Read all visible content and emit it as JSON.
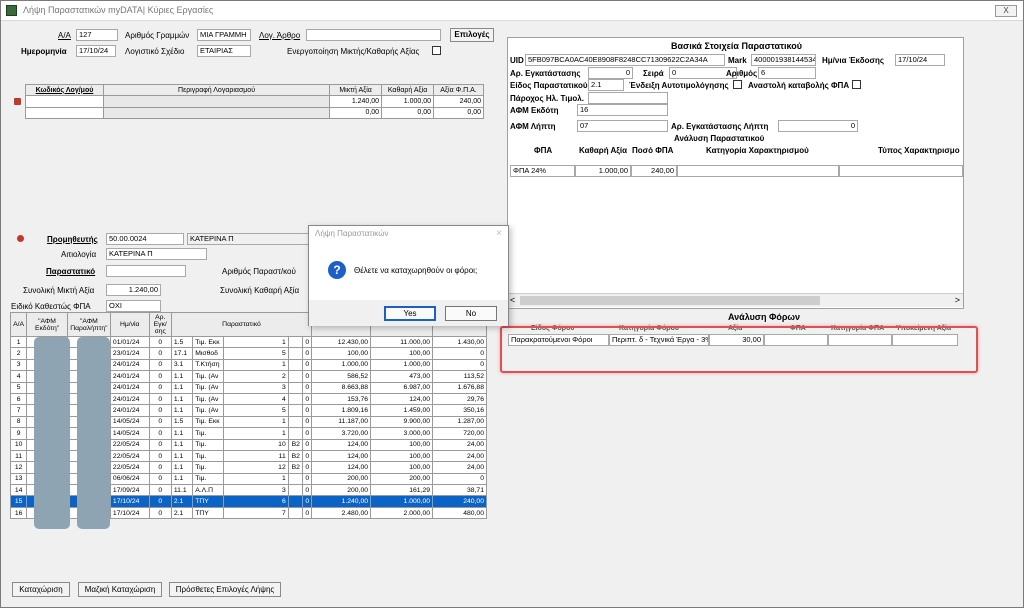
{
  "window": {
    "title": "Λήψη Παραστατικών myDATA| Κύριες Εργασίες",
    "close": "X"
  },
  "header": {
    "aa_label": "Α/Α",
    "aa_value": "127",
    "line_no_label": "Αριθμός Γραμμών",
    "line_no_value": "ΜΙΑ ΓΡΑΜΜΗ",
    "log_arthro_label": "Λογ. Άρθρο",
    "log_arthro_value": "",
    "options_button": "Επιλογές",
    "date_label": "Ημερομηνία",
    "date_value": "17/10/24",
    "plan_label": "Λογιστικό Σχέδιο",
    "plan_value": "ΕΤΑΙΡΙΑΣ",
    "mixed_label": "Ενεργοποίηση Μικτής/Καθαρής Αξίας"
  },
  "accounts_table": {
    "headers": [
      "Κωδικός Λογ/μού",
      "Περιγραφή Λογαριασμού",
      "Μικτή Αξία",
      "Καθαρή Αξία",
      "Αξία Φ.Π.Α."
    ],
    "rows": [
      [
        "",
        "",
        "1.240,00",
        "1.000,00",
        "240,00"
      ],
      [
        "",
        "",
        "0,00",
        "0,00",
        "0,00"
      ]
    ]
  },
  "supplier": {
    "label": "Προμηθευτής",
    "code": "50.00.0024",
    "name": "ΚΑΤΕΡΙΝΑ Π",
    "reason_label": "Αιτιολογία",
    "reason_value": "ΚΑΤΕΡΙΝΑ Π",
    "doc_label": "Παραστατικό",
    "doc_value": "",
    "doc_no_label": "Αριθμός Παραστ/κού",
    "gross_label": "Συνολική Μικτή Αξία",
    "gross_value": "1.240,00",
    "net_label": "Συνολική Καθαρή Αξία",
    "vat_status_label": "Ειδικό Καθεστώς ΦΠΑ",
    "vat_status_value": "ΟΧΙ"
  },
  "docs_table": {
    "headers": [
      "Α/Α",
      "\"ΑΦΜ Εκδότη\"",
      "\"ΑΦΜ Παραλήπτη\"",
      "Ημ/νία",
      "Αρ. Εγκ/σης",
      "Παραστατικό"
    ],
    "rows": [
      [
        "1",
        "",
        "",
        "01/01/24",
        "0",
        "1.5",
        "Τιμ. Εκκ",
        "1",
        "",
        "0",
        "12.430,00",
        "11.000,00",
        "1.430,00"
      ],
      [
        "2",
        "",
        "",
        "23/01/24",
        "0",
        "17.1",
        "Μισθοδ",
        "5",
        "",
        "0",
        "100,00",
        "100,00",
        "0"
      ],
      [
        "3",
        "",
        "",
        "24/01/24",
        "0",
        "3.1",
        "Τ.Κτήση",
        "1",
        "",
        "0",
        "1.000,00",
        "1.000,00",
        "0"
      ],
      [
        "4",
        "",
        "",
        "24/01/24",
        "0",
        "1.1",
        "Τιμ. (Αν",
        "2",
        "",
        "0",
        "586,52",
        "473,00",
        "113,52"
      ],
      [
        "5",
        "",
        "",
        "24/01/24",
        "0",
        "1.1",
        "Τιμ. (Αν",
        "3",
        "",
        "0",
        "8.663,88",
        "6.987,00",
        "1.676,88"
      ],
      [
        "6",
        "",
        "",
        "24/01/24",
        "0",
        "1.1",
        "Τιμ. (Αν",
        "4",
        "",
        "0",
        "153,76",
        "124,00",
        "29,76"
      ],
      [
        "7",
        "",
        "",
        "24/01/24",
        "0",
        "1.1",
        "Τιμ. (Αν",
        "5",
        "",
        "0",
        "1.809,16",
        "1.459,00",
        "350,16"
      ],
      [
        "8",
        "",
        "",
        "14/05/24",
        "0",
        "1.5",
        "Τιμ. Εκκ",
        "1",
        "",
        "0",
        "11.187,00",
        "9.900,00",
        "1.287,00"
      ],
      [
        "9",
        "",
        "",
        "14/05/24",
        "0",
        "1.1",
        "Τιμ.",
        "1",
        "",
        "0",
        "3.720,00",
        "3.000,00",
        "720,00"
      ],
      [
        "10",
        "",
        "",
        "22/05/24",
        "0",
        "1.1",
        "Τιμ.",
        "10",
        "B2",
        "0",
        "124,00",
        "100,00",
        "24,00"
      ],
      [
        "11",
        "",
        "",
        "22/05/24",
        "0",
        "1.1",
        "Τιμ.",
        "11",
        "B2",
        "0",
        "124,00",
        "100,00",
        "24,00"
      ],
      [
        "12",
        "",
        "",
        "22/05/24",
        "0",
        "1.1",
        "Τιμ.",
        "12",
        "B2",
        "0",
        "124,00",
        "100,00",
        "24,00"
      ],
      [
        "13",
        "",
        "",
        "06/06/24",
        "0",
        "1.1",
        "Τιμ.",
        "1",
        "",
        "0",
        "200,00",
        "200,00",
        "0"
      ],
      [
        "14",
        "",
        "",
        "17/09/24",
        "0",
        "11.1",
        "Α.Λ.Π",
        "3",
        "",
        "0",
        "200,00",
        "161,29",
        "38,71"
      ],
      [
        "15",
        "",
        "",
        "17/10/24",
        "0",
        "2.1",
        "ΤΠΥ",
        "6",
        "",
        "0",
        "1.240,00",
        "1.000,00",
        "240,00"
      ],
      [
        "16",
        "",
        "",
        "17/10/24",
        "0",
        "2.1",
        "ΤΠΥ",
        "7",
        "",
        "0",
        "2.480,00",
        "2.000,00",
        "480,00"
      ]
    ]
  },
  "bottom_buttons": [
    "Καταχώριση",
    "Μαζική Καταχώριση",
    "Πρόσθετες Επιλογές Λήψης"
  ],
  "basic": {
    "title": "Βασικά Στοιχεία Παραστατικού",
    "uid_label": "UID",
    "uid_value": "5FB097BCA0AC40E8908F8248CC71309622C2A34A",
    "mark_label": "Mark",
    "mark_value": "400001938144534",
    "issue_date_label": "Ημ/νια Έκδοσης",
    "issue_date_value": "17/10/24",
    "branch_label": "Αρ. Εγκατάστασης",
    "branch_value": "0",
    "series_label": "Σειρά",
    "series_value": "0",
    "number_label": "Αριθμός",
    "number_value": "6",
    "type_label": "Είδος Παραστατικού",
    "type_value": "2.1",
    "selfbill_label": "Ένδειξη Αυτοτιμολόγησης",
    "vat_suspend_label": "Αναστολή καταβολής ΦΠΑ",
    "provider_label": "Πάροχος Ηλ. Τιμολ.",
    "issuer_label": "ΑΦΜ Εκδότη",
    "issuer_value": "16",
    "recipient_label": "ΑΦΜ Λήπτη",
    "recipient_value": "07",
    "recipient_branch_label": "Αρ. Εγκατάστασης Λήπτη",
    "recipient_branch_value": "0"
  },
  "analysis": {
    "title": "Ανάλυση Παραστατικού",
    "headers": [
      "ΦΠΑ",
      "Καθαρή Αξία",
      "Ποσό ΦΠΑ",
      "Κατηγορία Χαρακτηρισμού",
      "Τύπος Χαρακτηρισμο"
    ],
    "rows": [
      [
        "ΦΠΑ 24%",
        "1.000,00",
        "240,00",
        "",
        ""
      ]
    ]
  },
  "taxes": {
    "title": "Ανάλυση Φόρων",
    "headers": [
      "Είδος Φόρου",
      "Κατηγορία Φόρου",
      "Αξία",
      "ΦΠΑ",
      "Κατηγορία ΦΠΑ",
      "Υποκείμενη Αξία"
    ],
    "rows": [
      [
        "Παρακρατούμενοι Φόροι",
        "Περιπτ. δ - Τεχνικά Έργα - 3%",
        "30,00",
        "",
        "",
        ""
      ]
    ]
  },
  "dialog": {
    "title": "Λήψη Παραστατικών",
    "message": "Θέλετε να καταχωρηθούν οι φόροι;",
    "yes": "Yes",
    "no": "No"
  },
  "colors": {
    "selected_row": "#0a64c8",
    "highlight": "#e05050",
    "question_icon": "#1c5fc9"
  }
}
